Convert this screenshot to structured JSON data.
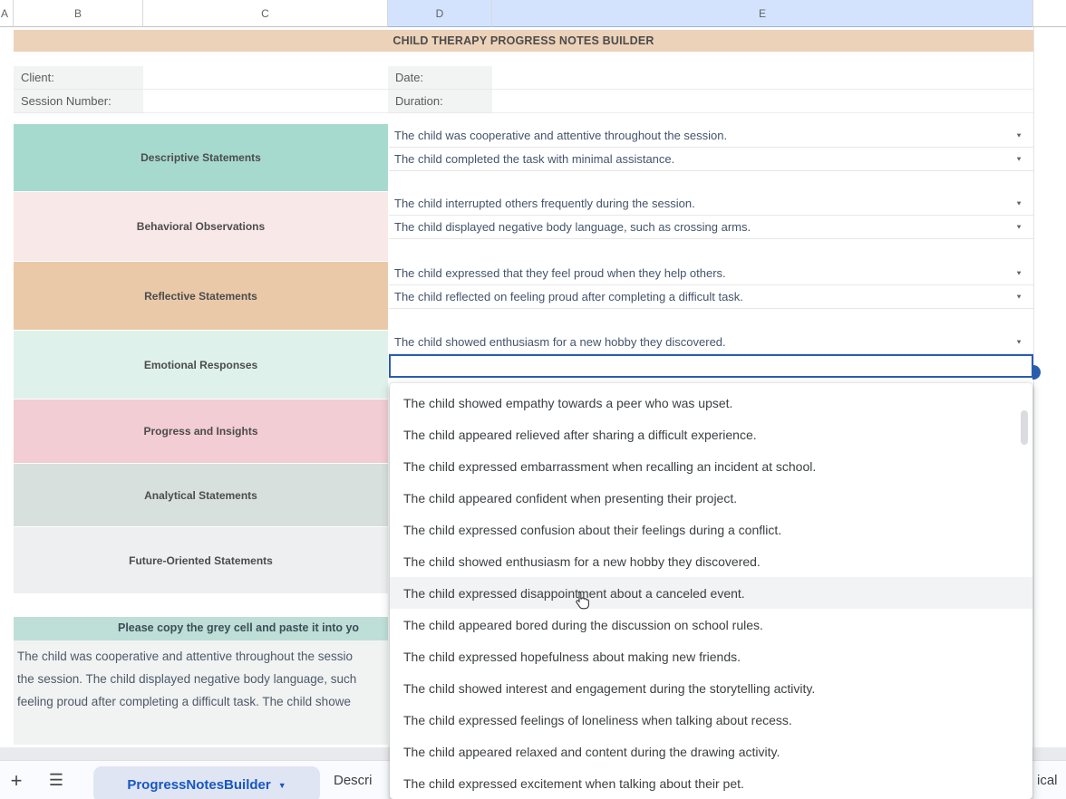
{
  "colors": {
    "selected_col_header": "#d3e3fd",
    "title_band": "#ecd2b9",
    "copy_band": "#bedfd8",
    "active_cell_border": "#2a5cad",
    "active_tab_bg": "#dfe5f2",
    "active_tab_text": "#1757c2",
    "hover_item_bg": "#f1f3f4"
  },
  "column_headers": {
    "a": "A",
    "b": "B",
    "c": "C",
    "d": "D",
    "e": "E"
  },
  "title": "CHILD THERAPY PROGRESS NOTES BUILDER",
  "info_fields": {
    "client_label": "Client:",
    "session_label": "Session Number:",
    "date_label": "Date:",
    "duration_label": "Duration:"
  },
  "categories": [
    {
      "label": "Descriptive Statements",
      "color": "#a7dacf",
      "statements": [
        "The child was cooperative and attentive throughout the session.",
        "The child completed the task with minimal assistance."
      ]
    },
    {
      "label": "Behavioral Observations",
      "color": "#f8e8e7",
      "statements": [
        "The child interrupted others frequently during the session.",
        "The child displayed negative body language, such as crossing arms."
      ]
    },
    {
      "label": "Reflective Statements",
      "color": "#eac9a9",
      "statements": [
        "The child expressed that they feel proud when they help others.",
        "The child reflected on feeling proud after completing a difficult task."
      ]
    },
    {
      "label": "Emotional Responses",
      "color": "#dff1eb",
      "statements": [
        "The child showed enthusiasm for a new hobby they discovered."
      ]
    },
    {
      "label": "Progress and Insights",
      "color": "#f2cdd3",
      "statements": []
    },
    {
      "label": "Analytical Statements",
      "color": "#d8e0dd",
      "statements": []
    },
    {
      "label": "Future-Oriented Statements",
      "color": "#edeff1",
      "statements": []
    }
  ],
  "active_cell": {
    "value": "",
    "column": "D",
    "has_dropdown": true
  },
  "dropdown": {
    "hovered_index": 6,
    "items": [
      "The child showed empathy towards a peer who was upset.",
      "The child appeared relieved after sharing a difficult experience.",
      "The child expressed embarrassment when recalling an incident at school.",
      "The child appeared confident when presenting their project.",
      "The child expressed confusion about their feelings during a conflict.",
      "The child showed enthusiasm for a new hobby they discovered.",
      "The child expressed disappointment about a canceled event.",
      "The child appeared bored during the discussion on school rules.",
      "The child expressed hopefulness about making new friends.",
      "The child showed interest and engagement during the storytelling activity.",
      "The child expressed feelings of loneliness when talking about recess.",
      "The child appeared relaxed and content during the drawing activity.",
      "The child expressed excitement when talking about their pet."
    ]
  },
  "copy_banner_fragment": "Please copy the grey cell and paste it into yo",
  "paragraph_lines": {
    "0": "The child was cooperative and attentive throughout the sessio",
    "1": "the session. The child displayed negative body language, such ",
    "2": "feeling proud after completing a difficult task.  The child showe"
  },
  "sheet_tabs": {
    "add_icon": "+",
    "menu_icon": "☰",
    "active_tab": "ProgressNotesBuilder",
    "active_tab_caret": "▼",
    "next_tab_fragment": "Descri",
    "right_tab_fragment": "ical"
  },
  "dropdown_arrow_glyph": "▼"
}
